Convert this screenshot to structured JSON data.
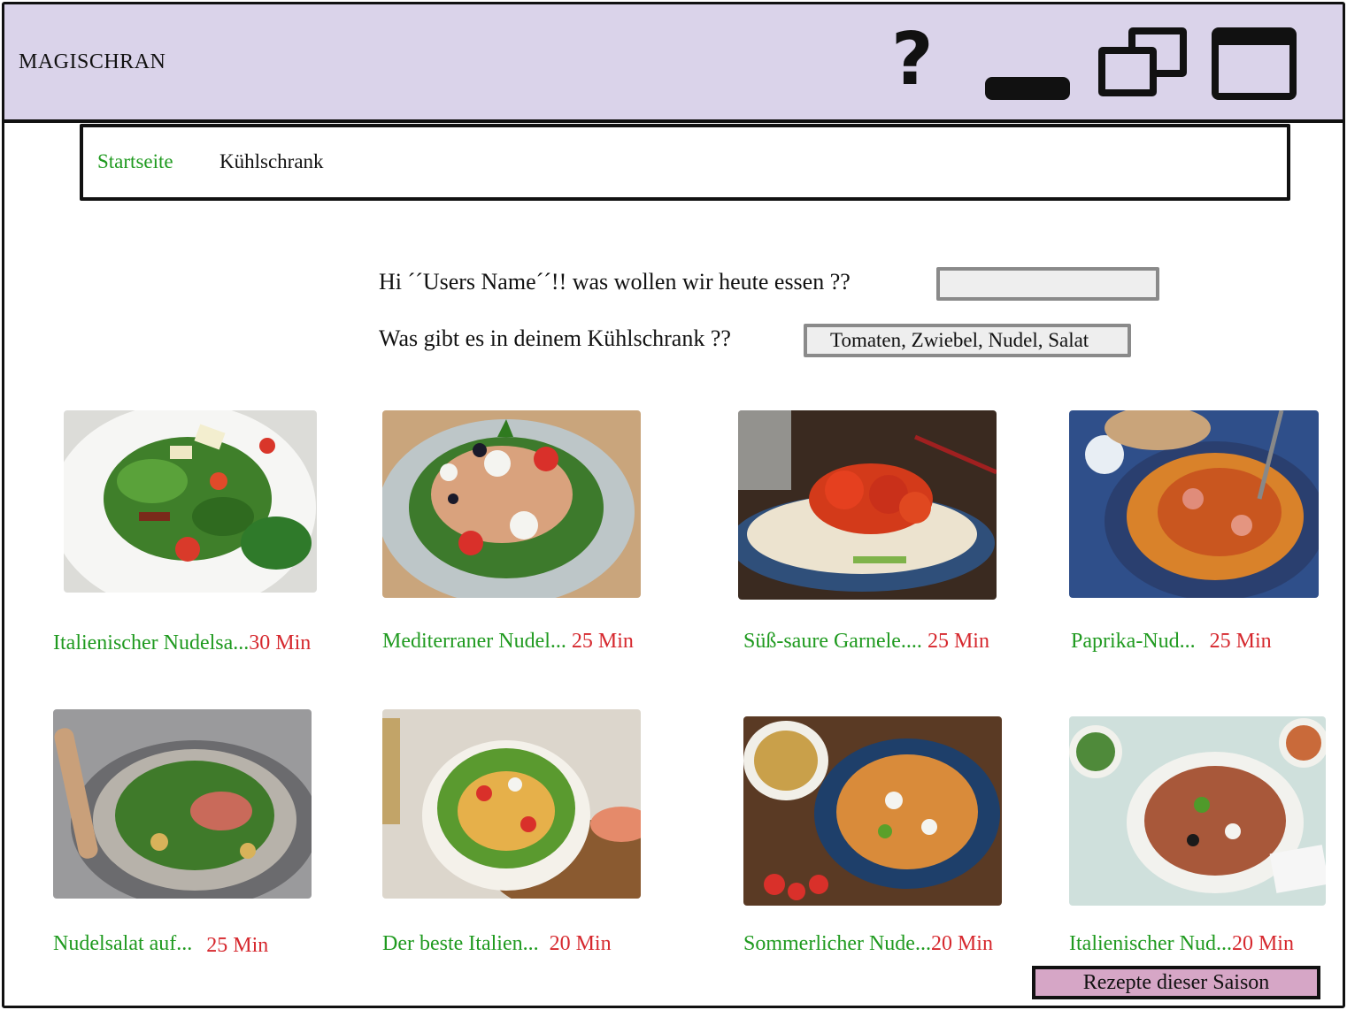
{
  "app": {
    "title": "MAGISCHRAN"
  },
  "window_controls": {
    "help_icon": "question-mark-icon",
    "minimize_icon": "minimize-icon",
    "restore_icon": "restore-icon",
    "maximize_icon": "maximize-icon",
    "help_glyph": "?"
  },
  "nav": {
    "items": [
      {
        "label": "Startseite",
        "active": true
      },
      {
        "label": "Kühlschrank",
        "active": false
      }
    ]
  },
  "greeting": {
    "question": "Hi ´´Users Name´´!! was wollen wir heute essen ??",
    "search_value": ""
  },
  "fridge": {
    "question": "Was gibt es in deinem Kühlschrank ??",
    "value": "Tomaten, Zwiebel, Nudel, Salat"
  },
  "recipes": [
    {
      "name": "Italienischer Nudelsa...",
      "time": "30 Min"
    },
    {
      "name": "Mediterraner Nudel...",
      "time": "25 Min"
    },
    {
      "name": "Süß-saure Garnele....",
      "time": "25 Min"
    },
    {
      "name": "Paprika-Nud...",
      "time": "25 Min"
    },
    {
      "name": "Nudelsalat auf...",
      "time": "25 Min"
    },
    {
      "name": "Der beste Italien...",
      "time": "20 Min"
    },
    {
      "name": "Sommerlicher Nude...",
      "time": "20 Min"
    },
    {
      "name": "Italienischer Nud...",
      "time": "20 Min"
    }
  ],
  "season_button": {
    "label": "Rezepte dieser Saison"
  },
  "colors": {
    "titlebar": "#dad3ea",
    "link_green": "#1f9a1f",
    "time_red": "#d6282e",
    "season_button": "#d6a6c6"
  }
}
